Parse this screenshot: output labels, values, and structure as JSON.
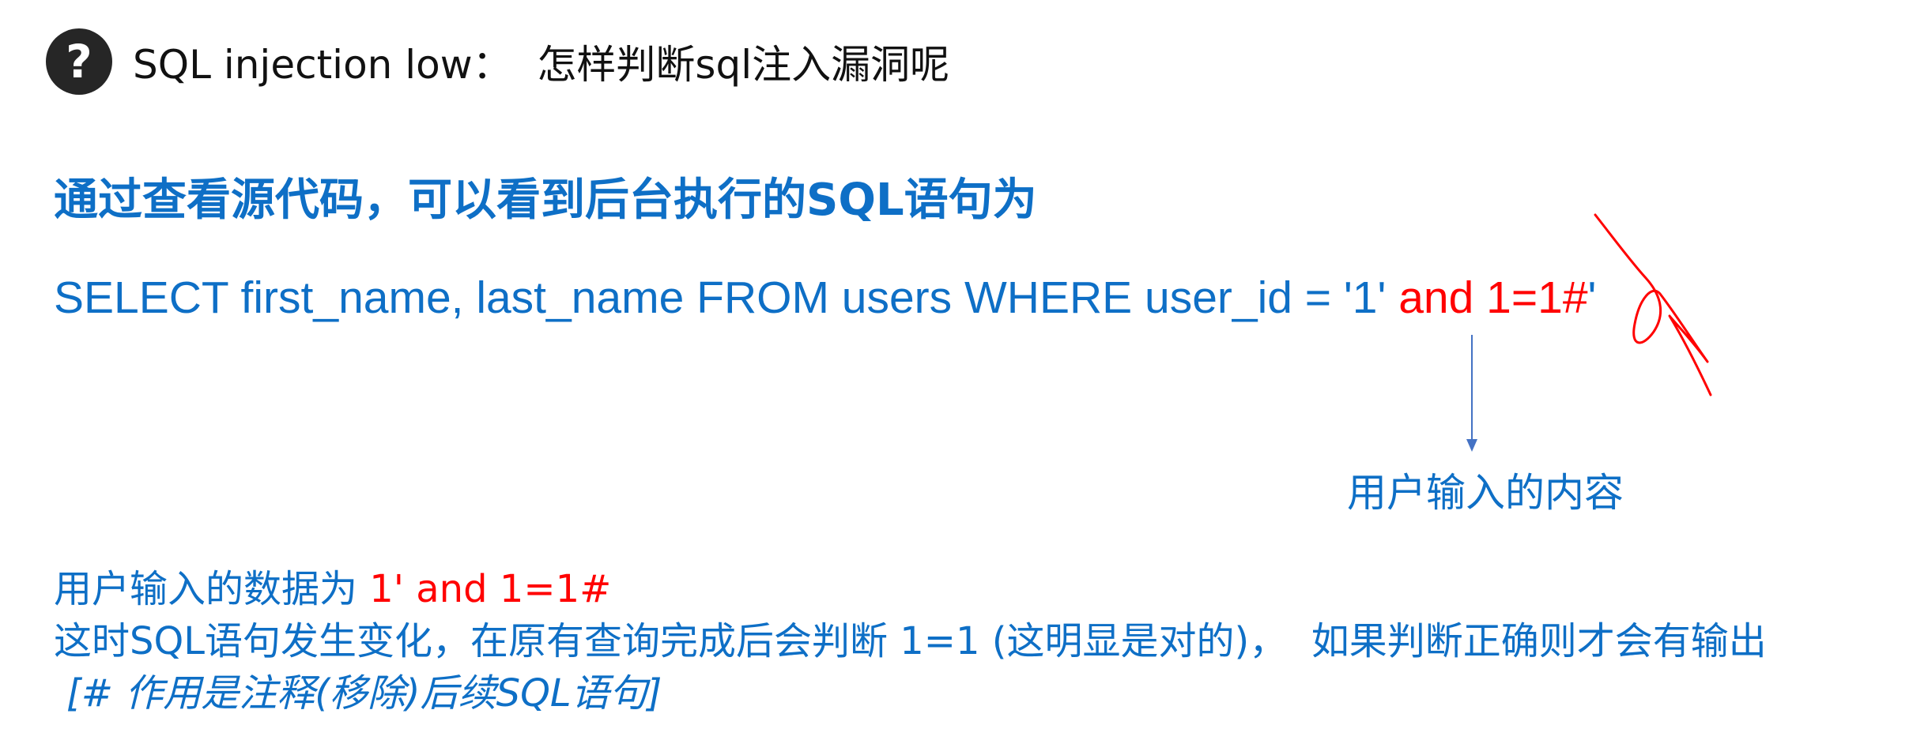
{
  "header": {
    "icon": "question-icon",
    "title": "SQL injection low：  怎样判断sql注入漏洞呢"
  },
  "intro": "通过查看源代码，可以看到后台执行的SQL语句为",
  "sql": {
    "prefix": "SELECT first_name, last_name FROM users WHERE user_id = '1'",
    "injected": " and 1=1#",
    "suffix": "'"
  },
  "callout": "用户输入的内容",
  "input_line": {
    "label": "用户输入的数据为 ",
    "value": "1' and 1=1#"
  },
  "explanation": "这时SQL语句发生变化，在原有查询完成后会判断 1=1 (这明显是对的)，  如果判断正确则才会有输出",
  "comment_note": "[# 作用是注释(移除)后续SQL语句]",
  "colors": {
    "blue": "#0e6fc6",
    "red": "#ff0000",
    "arrow": "#4472c4",
    "icon_bg": "#262626"
  }
}
